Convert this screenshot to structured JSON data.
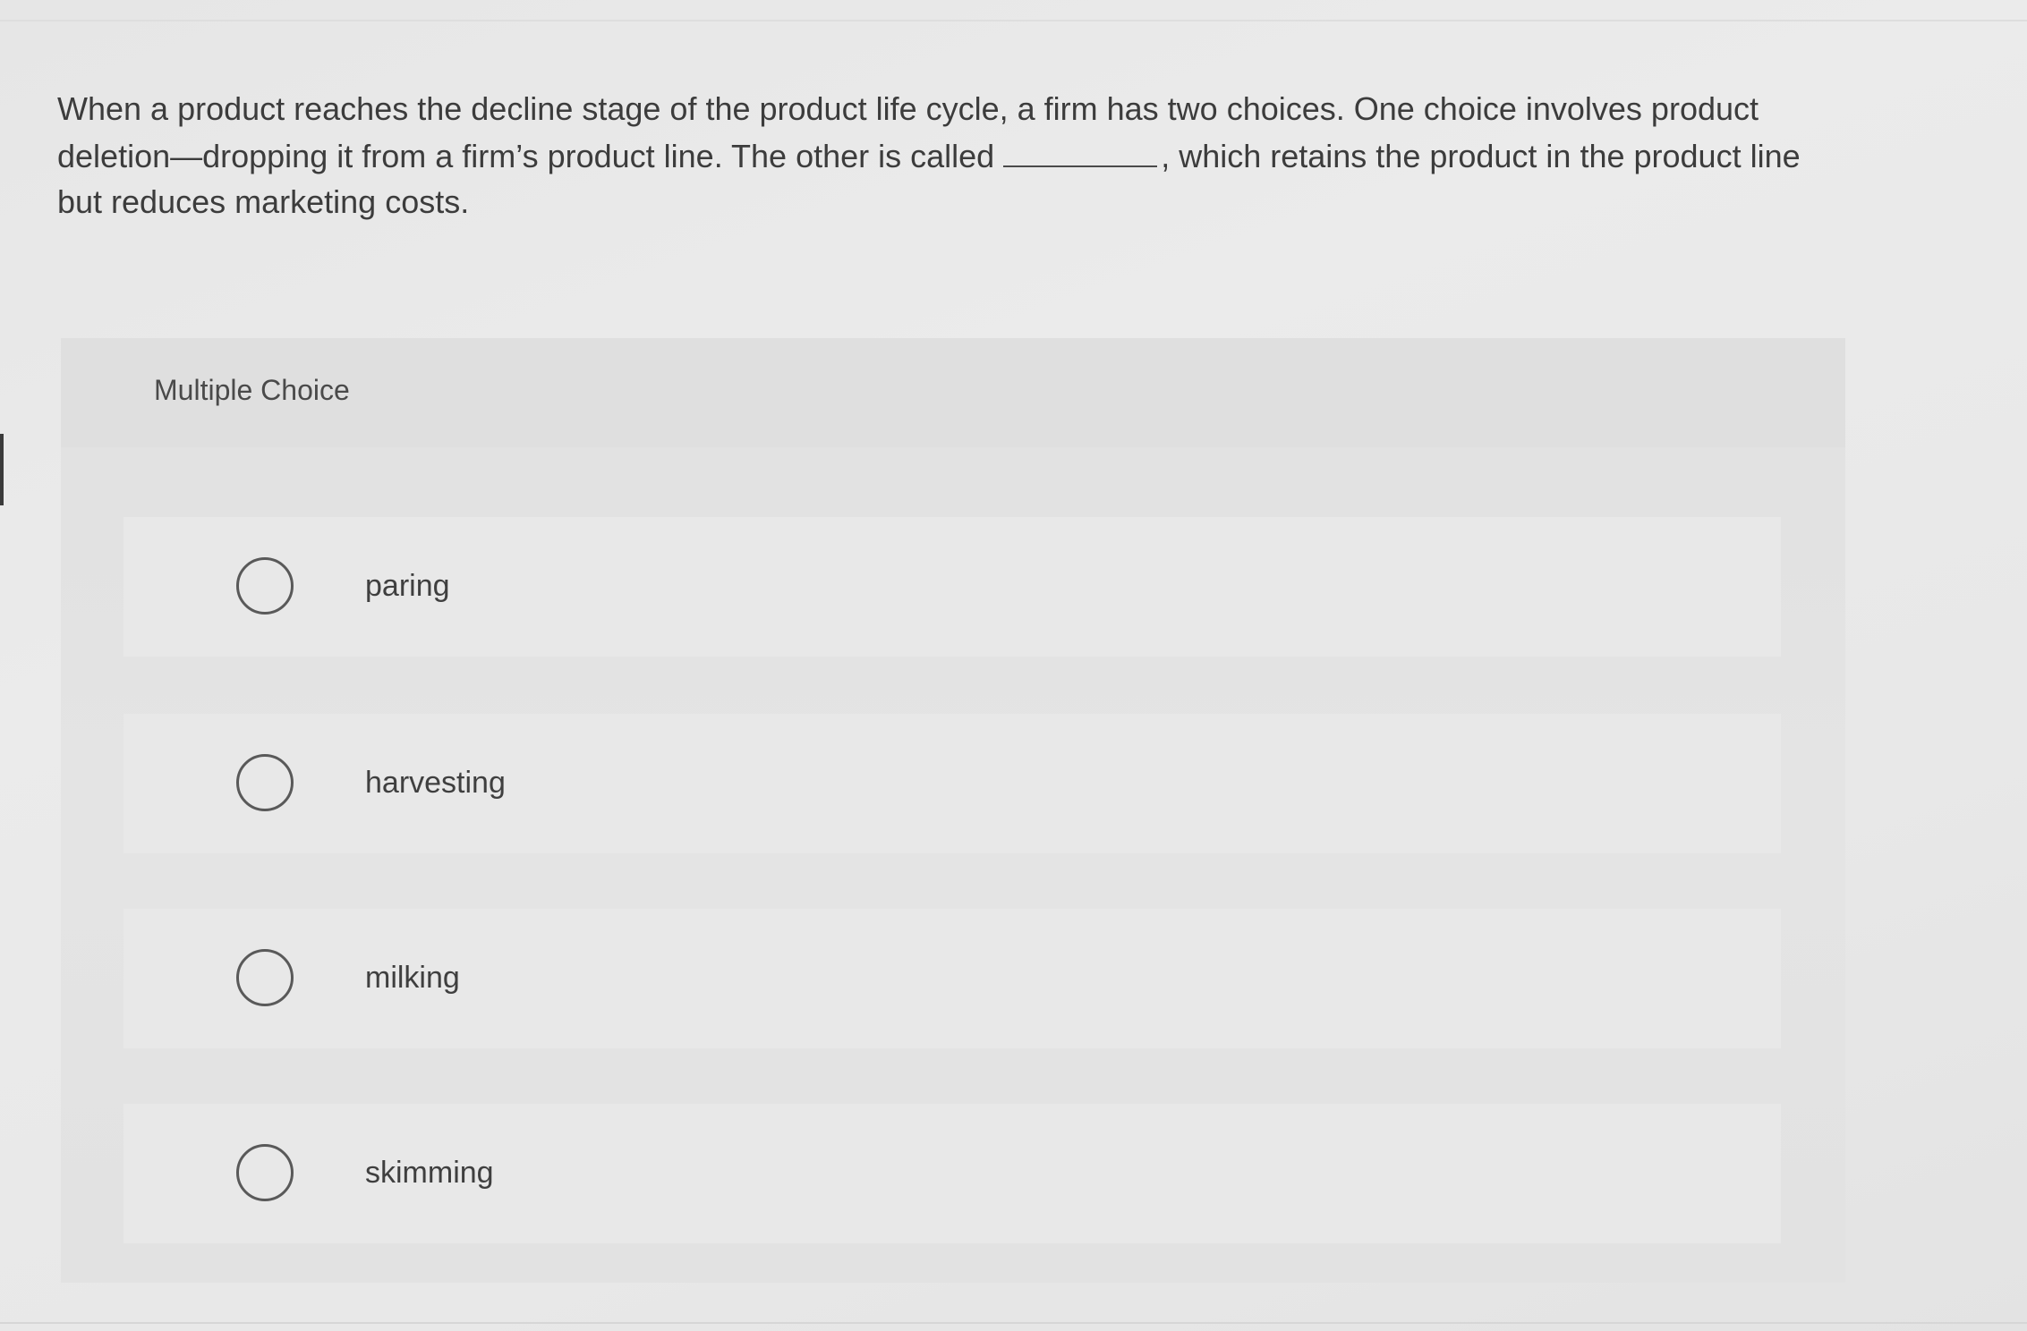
{
  "question": {
    "text_before_blank": "When a product reaches the decline stage of the product life cycle, a firm has two choices. One choice involves product deletion—dropping it from a firm’s product line. The other is called",
    "text_after_blank": ", which retains the product in the product line but reduces marketing costs."
  },
  "multiple_choice": {
    "label": "Multiple Choice",
    "options": [
      {
        "label": "paring",
        "selected": false
      },
      {
        "label": "harvesting",
        "selected": false
      },
      {
        "label": "milking",
        "selected": false
      },
      {
        "label": "skimming",
        "selected": false
      }
    ]
  }
}
